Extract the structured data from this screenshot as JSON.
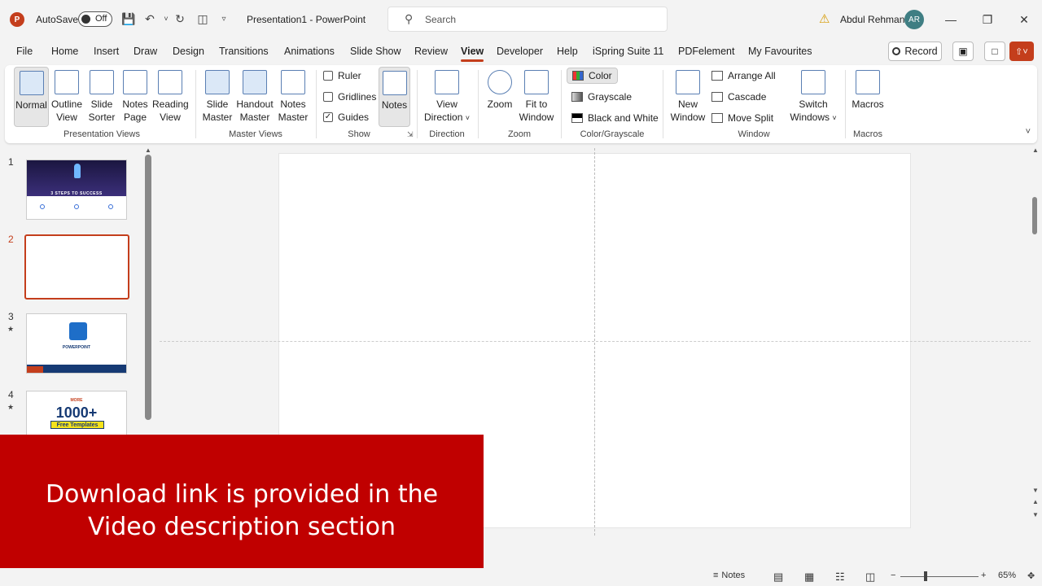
{
  "app": {
    "autosave_label": "AutoSave",
    "autosave_state": "Off",
    "doc_title": "Presentation1  -  PowerPoint",
    "search_placeholder": "Search",
    "user_name": "Abdul Rehman",
    "user_initials": "AR",
    "logo_letter": "P"
  },
  "tabs": [
    "File",
    "Home",
    "Insert",
    "Draw",
    "Design",
    "Transitions",
    "Animations",
    "Slide Show",
    "Review",
    "View",
    "Developer",
    "Help",
    "iSpring Suite 11",
    "PDFelement",
    "My Favourites"
  ],
  "active_tab": "View",
  "record_label": "Record",
  "ribbon": {
    "presentation_views": {
      "label": "Presentation Views",
      "normal": "Normal",
      "outline": [
        "Outline",
        "View"
      ],
      "sorter": [
        "Slide",
        "Sorter"
      ],
      "notes_page": [
        "Notes",
        "Page"
      ],
      "reading": [
        "Reading",
        "View"
      ]
    },
    "master_views": {
      "label": "Master Views",
      "slide": [
        "Slide",
        "Master"
      ],
      "handout": [
        "Handout",
        "Master"
      ],
      "notes": [
        "Notes",
        "Master"
      ]
    },
    "show": {
      "label": "Show",
      "ruler": "Ruler",
      "gridlines": "Gridlines",
      "guides": "Guides",
      "notes": "Notes"
    },
    "direction": {
      "label": "Direction",
      "view_direction": [
        "View",
        "Direction"
      ]
    },
    "zoom": {
      "label": "Zoom",
      "zoom": "Zoom",
      "fit": [
        "Fit to",
        "Window"
      ]
    },
    "color": {
      "label": "Color/Grayscale",
      "color": "Color",
      "grayscale": "Grayscale",
      "bw": "Black and White"
    },
    "window": {
      "label": "Window",
      "new_window": [
        "New",
        "Window"
      ],
      "arrange_all": "Arrange All",
      "cascade": "Cascade",
      "move_split": "Move Split",
      "switch": [
        "Switch",
        "Windows"
      ]
    },
    "macros": {
      "label": "Macros",
      "macros": "Macros"
    }
  },
  "slides": {
    "numbers": [
      "1",
      "2",
      "3",
      "4"
    ],
    "s1_title": "3 STEPS TO SUCCESS",
    "s3_title": "POWERPOINT",
    "s4_big": "1000+",
    "s4_badge": "Free Templates",
    "s4_top": "MORE"
  },
  "banner": {
    "line1": "Download link is provided in the",
    "line2": "Video description section"
  },
  "status": {
    "notes": "Notes",
    "zoom": "65%"
  }
}
